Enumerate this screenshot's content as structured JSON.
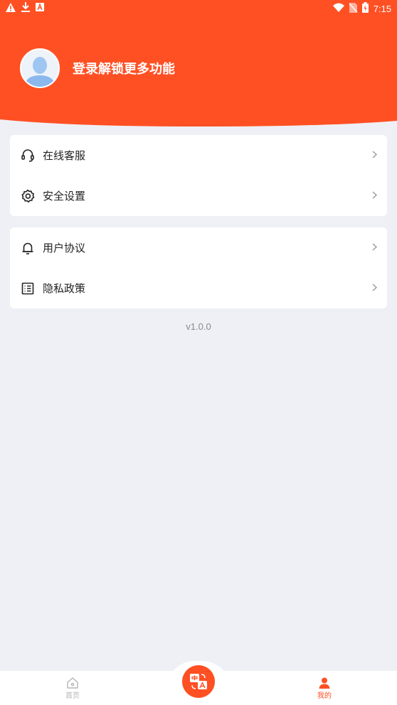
{
  "status_bar": {
    "time": "7:15",
    "icons_left": [
      "warning-icon",
      "download-icon",
      "a-box-icon"
    ],
    "icons_right": [
      "wifi-icon",
      "no-sim-icon",
      "battery-charging-icon"
    ]
  },
  "profile": {
    "login_prompt": "登录解锁更多功能"
  },
  "menu_group_1": [
    {
      "label": "在线客服",
      "icon": "headset-icon"
    },
    {
      "label": "安全设置",
      "icon": "gear-icon"
    }
  ],
  "menu_group_2": [
    {
      "label": "用户协议",
      "icon": "bell-icon"
    },
    {
      "label": "隐私政策",
      "icon": "list-icon"
    }
  ],
  "version": "v1.0.0",
  "tabbar": {
    "home_label": "首页",
    "mine_label": "我的",
    "center_icon": "translate-icon"
  },
  "colors": {
    "accent": "#ff5024",
    "background": "#eff0f5",
    "tab_inactive": "#b5b5b5"
  }
}
